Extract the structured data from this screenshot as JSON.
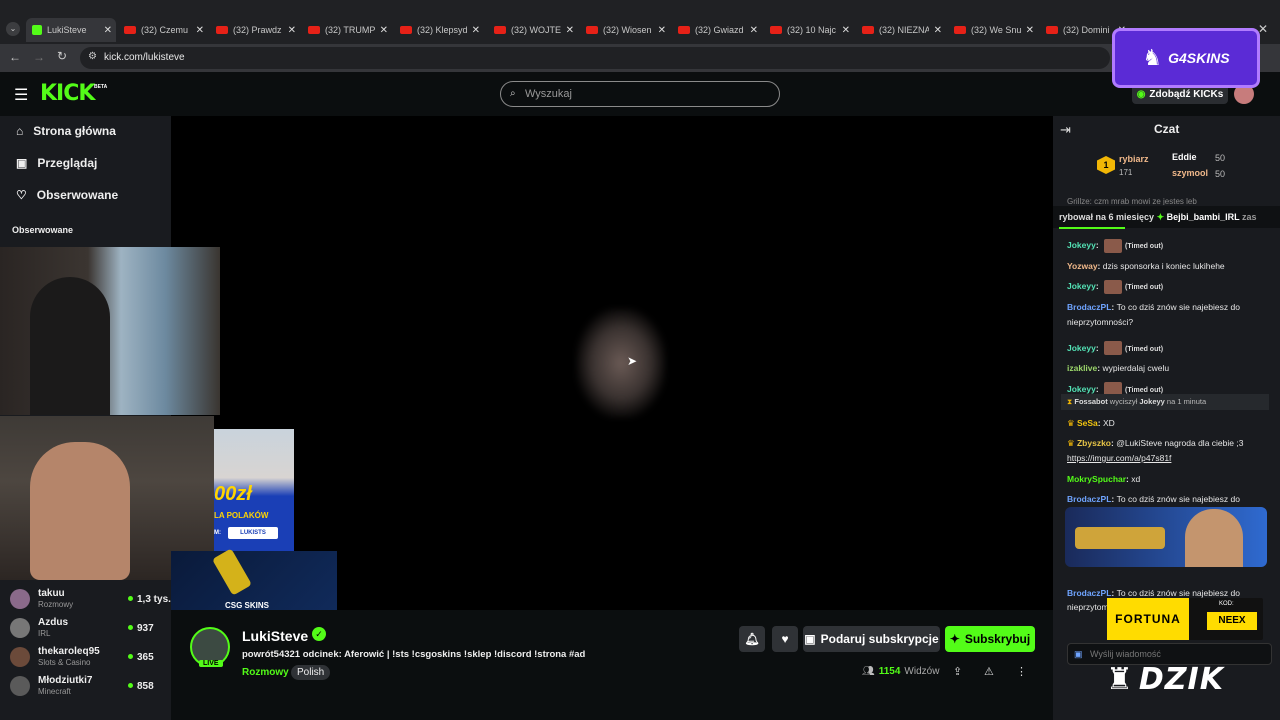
{
  "browser": {
    "tabs": [
      {
        "label": "LukiSteve",
        "active": true
      },
      {
        "label": "(32) Czemu"
      },
      {
        "label": "(32) Prawdz"
      },
      {
        "label": "(32) TRUMP"
      },
      {
        "label": "(32) Klepsyd"
      },
      {
        "label": "(32) WOJTEK"
      },
      {
        "label": "(32) Wiosen"
      },
      {
        "label": "(32) Gwiazd"
      },
      {
        "label": "(32) 10 Najc"
      },
      {
        "label": "(32) NIEZNA"
      },
      {
        "label": "(32) We Snu"
      },
      {
        "label": "(32) Domini"
      }
    ],
    "url": "kick.com/lukisteve"
  },
  "header": {
    "logo": "KICK",
    "beta": "BETA",
    "search_placeholder": "Wyszukaj",
    "kicks_label": "Zdobądź KICKs",
    "sponsor_logo": "G4SKINS"
  },
  "sidebar": {
    "nav": [
      "Strona główna",
      "Przeglądaj",
      "Obserwowane"
    ],
    "followed_title": "Obserwowane",
    "followed": [
      {
        "name": "takuu",
        "category": "Rozmowy",
        "viewers": "1,3 tys."
      },
      {
        "name": "Azdus",
        "category": "IRL",
        "viewers": "937"
      },
      {
        "name": "thekaroleq95",
        "category": "Slots & Casino",
        "viewers": "365"
      },
      {
        "name": "Młodziutki7",
        "category": "Minecraft",
        "viewers": "858"
      }
    ]
  },
  "overlays": {
    "promo_amount": "00zł",
    "promo_text": "LA POLAKÓW",
    "promo_code": "LUKISTS",
    "promo_code_prefix": "M:",
    "csgo_label": "CSG SKINS"
  },
  "stream": {
    "streamer": "LukiSteve",
    "live": "LIVE",
    "title": "powrót54321 odcinek: Aferowić | !sts !csgoskins !sklep !discord !strona #ad",
    "category": "Rozmowy",
    "language": "Polish",
    "viewers": "1154",
    "viewers_label": "Widzów",
    "gift_button": "Podaruj subskrypcje",
    "subscribe_button": "Subskrybuj"
  },
  "chat": {
    "title": "Czat",
    "leaderboard": [
      {
        "rank": "1",
        "name": "rybiarz",
        "value": "171"
      },
      {
        "name": "Eddie",
        "value": "50"
      },
      {
        "name": "szymool",
        "value": "50"
      }
    ],
    "partial_line": "Grillze: czm mrab mowi ze jestes leb",
    "ticker": "rybował na 6 miesięcy",
    "ticker_user": "Bejbi_bambi_IRL",
    "ticker_tail": "zas",
    "messages": [
      {
        "user": "Jokeyy",
        "color": "#53e2b5",
        "timeout": true,
        "text": "(Timed out)"
      },
      {
        "user": "Yozway",
        "color": "#f0b88a",
        "text": "dzis sponsorka i koniec lukihehe"
      },
      {
        "user": "Jokeyy",
        "color": "#53e2b5",
        "timeout": true,
        "text": "(Timed out)"
      },
      {
        "user": "BrodaczPL",
        "color": "#6fa4ff",
        "text": "To co dziś znów sie najebiesz do nieprzytomności?"
      },
      {
        "user": "Jokeyy",
        "color": "#53e2b5",
        "timeout": true,
        "text": "(Timed out)"
      },
      {
        "user": "izaklive",
        "color": "#9bd66a",
        "text": "wypierdalaj cwelu"
      },
      {
        "user": "Jokeyy",
        "color": "#53e2b5",
        "timeout": true,
        "text": "(Timed out)"
      }
    ],
    "mod_action": {
      "mod": "Fossabot",
      "verb": "wyciszył",
      "target": "Jokeyy",
      "duration": "na 1 minuta"
    },
    "messages2": [
      {
        "user": "SeSa",
        "color": "#f1c40f",
        "text": "XD"
      },
      {
        "user": "Zbyszko",
        "color": "#e8c547",
        "text": "@LukiSteve nagroda dla ciebie ;3"
      },
      {
        "user": "",
        "color": "#e6e6e6",
        "text": "https://imgur.com/a/p47s81f",
        "link": true
      },
      {
        "user": "MokrySpuchar",
        "color": "#53fc18",
        "text": "xd"
      },
      {
        "user": "BrodaczPL",
        "color": "#6fa4ff",
        "text": "To co dziś znów sie najebiesz do"
      },
      {
        "user": "",
        "color": "#e6e6e6",
        "text": "nieprzytomności"
      },
      {
        "user": "BrodaczPL",
        "color": "#6fa4ff",
        "text": "To co dziś znów sie najebiesz do"
      },
      {
        "user": "",
        "color": "#e6e6e6",
        "text": "nieprzytomności?"
      }
    ],
    "ad_fortuna": "FORTUNA",
    "ad_code_label": "KOD:",
    "ad_code": "NEEX",
    "input_placeholder": "Wyślij wiadomość"
  },
  "watermark": "DZIK",
  "colors": {
    "accent": "#53fc18",
    "bg": "#0b0e0f",
    "panel": "#191b1f"
  }
}
